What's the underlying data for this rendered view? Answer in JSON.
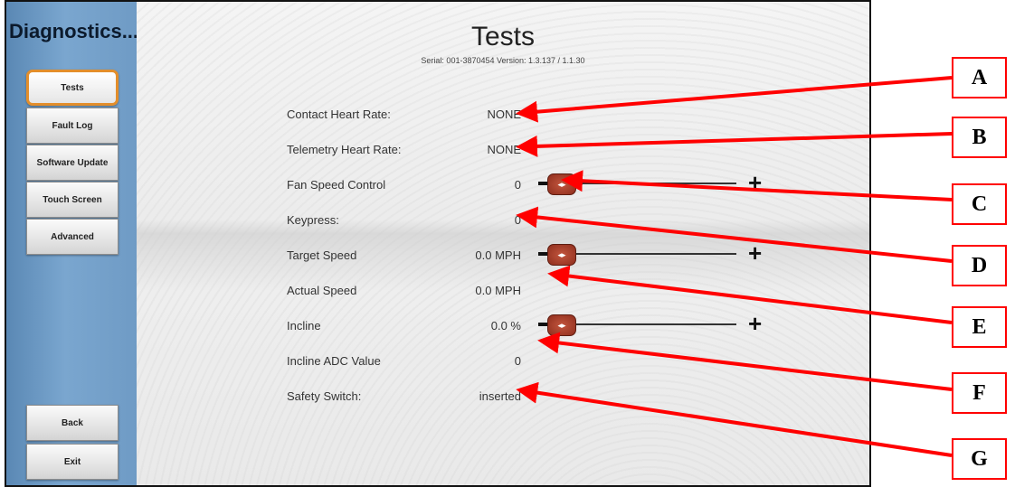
{
  "app_title": "Diagnostics...",
  "sidebar": {
    "items": [
      "Tests",
      "Fault Log",
      "Software Update",
      "Touch Screen",
      "Advanced"
    ],
    "back_label": "Back",
    "exit_label": "Exit"
  },
  "page": {
    "title": "Tests",
    "serial_line": "Serial: 001-3870454   Version: 1.3.137 / 1.1.30"
  },
  "rows": [
    {
      "label": "Contact Heart Rate:",
      "value": "NONE"
    },
    {
      "label": "Telemetry Heart Rate:",
      "value": "NONE"
    },
    {
      "label": "Fan Speed Control",
      "value": "0"
    },
    {
      "label": "Keypress:",
      "value": "0"
    },
    {
      "label": "Target Speed",
      "value": "0.0 MPH"
    },
    {
      "label": "Actual Speed",
      "value": "0.0 MPH"
    },
    {
      "label": "Incline",
      "value": "0.0 %"
    },
    {
      "label": "Incline ADC Value",
      "value": "0"
    },
    {
      "label": "Safety Switch:",
      "value": "inserted"
    }
  ],
  "slider": {
    "handle_glyph": "◂▸",
    "minus_glyph": "–",
    "plus_glyph": "+"
  },
  "callouts": [
    "A",
    "B",
    "C",
    "D",
    "E",
    "F",
    "G"
  ],
  "colors": {
    "accent_active": "#e38e2b",
    "callout_red": "#ff0000",
    "sidebar_blue": "#6f9bc5"
  }
}
